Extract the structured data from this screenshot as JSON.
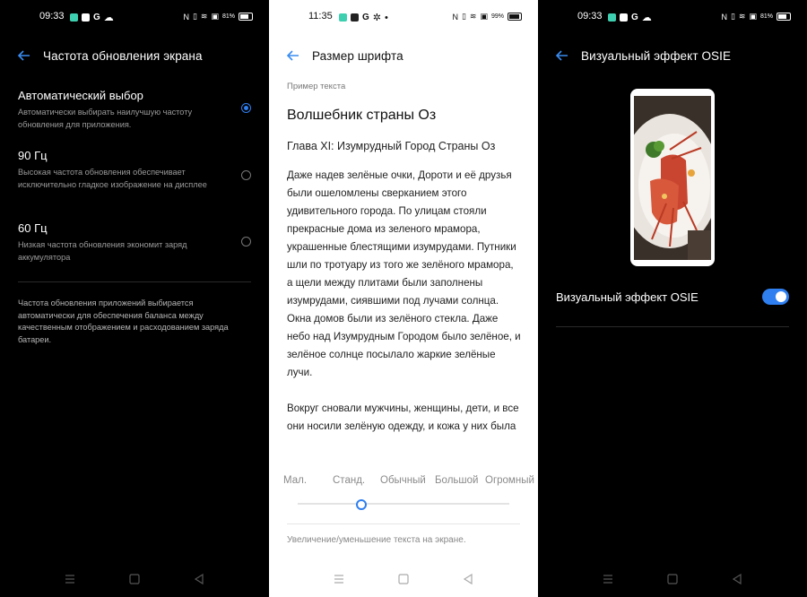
{
  "panel1": {
    "status": {
      "time": "09:33",
      "battery": "81%"
    },
    "title": "Частота обновления экрана",
    "options": [
      {
        "title": "Автоматический выбор",
        "desc": "Автоматически выбирать наилучшую частоту обновления для приложения.",
        "selected": true
      },
      {
        "title": "90 Гц",
        "desc": "Высокая частота обновления обеспечивает исключительно гладкое изображение на дисплее",
        "selected": false
      },
      {
        "title": "60 Гц",
        "desc": "Низкая частота обновления экономит заряд аккумулятора",
        "selected": false
      }
    ],
    "note": "Частота обновления приложений выбирается автоматически для обеспечения баланса между качественным отображением и расходованием заряда батареи."
  },
  "panel2": {
    "status": {
      "time": "11:35",
      "battery": "99%"
    },
    "title": "Размер шрифта",
    "sample_label": "Пример текста",
    "book_title": "Волшебник страны Оз",
    "chapter": "Глава XI: Изумрудный Город Страны Оз",
    "paragraphs": [
      "Даже надев зелёные очки, Дороти и её друзья были ошеломлены сверканием этого удивительного города. По улицам стояли прекрасные дома из зеленого мрамора, украшенные блестящими изумрудами. Путники шли по тротуару из того же зелёного мрамора, а щели между плитами были заполнены изумрудами, сиявшими под лучами солнца. Окна домов были из зелёного стекла. Даже небо над Изумрудным Городом было зелёное, и зелёное солнце посылало жаркие зелёные лучи.",
      "Вокруг сновали мужчины, женщины, дети, и все они носили зелёную одежду, и кожа у них была зеленоватого оттенка."
    ],
    "sizes": [
      "Мал.",
      "Станд.",
      "Обычный",
      "Большой",
      "Огромный"
    ],
    "selected_size_index": 1,
    "hint": "Увеличение/уменьшение текста на экране."
  },
  "panel3": {
    "status": {
      "time": "09:33",
      "battery": "81%"
    },
    "title": "Визуальный эффект OSIE",
    "toggle_label": "Визуальный эффект OSIE",
    "toggle_on": true
  },
  "colors": {
    "accent": "#2f7ff0",
    "dark_bg": "#000000",
    "light_bg": "#ffffff"
  }
}
